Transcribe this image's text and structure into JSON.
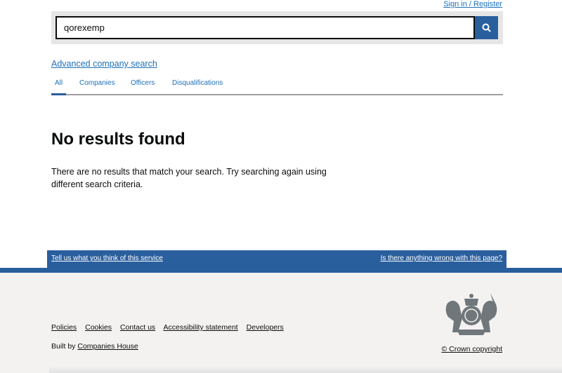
{
  "header": {
    "signin_label": "Sign in / Register"
  },
  "search": {
    "value": "qorexemp",
    "button_icon": "search-icon"
  },
  "advanced_link": "Advanced company search",
  "tabs": [
    {
      "label": "All",
      "active": true
    },
    {
      "label": "Companies"
    },
    {
      "label": "Officers"
    },
    {
      "label": "Disqualifications"
    }
  ],
  "main": {
    "title": "No results found",
    "message": "There are no results that match your search. Try searching again using different search criteria."
  },
  "feedback": {
    "left": "Tell us what you think of this service",
    "right": "Is there anything wrong with this page?"
  },
  "footer": {
    "links": [
      "Policies",
      "Cookies",
      "Contact us",
      "Accessibility statement",
      "Developers"
    ],
    "built_by": "Built by",
    "built_by_link": "Companies House",
    "copyright": "© Crown copyright",
    "crest_icon": "royal-coat-of-arms-icon"
  },
  "colors": {
    "brand_blue": "#2a5f9e",
    "link": "#1d70b8",
    "footer_bg": "#f3f2f1"
  }
}
